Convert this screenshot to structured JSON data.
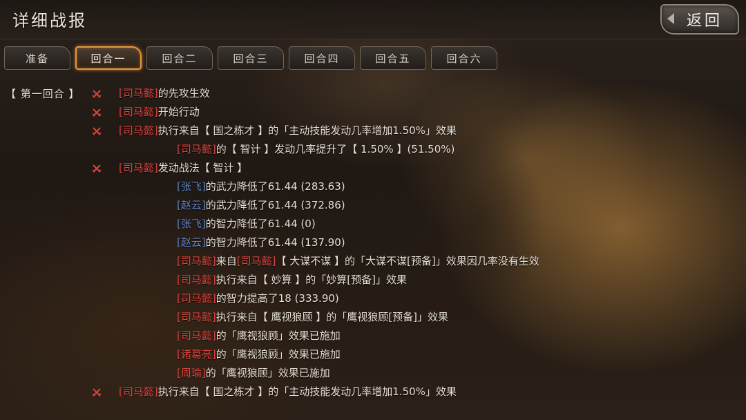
{
  "header": {
    "title": "详细战报",
    "back_label": "返回"
  },
  "tabs": [
    {
      "label": "准备",
      "active": false
    },
    {
      "label": "回合一",
      "active": true
    },
    {
      "label": "回合二",
      "active": false
    },
    {
      "label": "回合三",
      "active": false
    },
    {
      "label": "回合四",
      "active": false
    },
    {
      "label": "回合五",
      "active": false
    },
    {
      "label": "回合六",
      "active": false
    }
  ],
  "colors": {
    "accent_orange": "#e7973d",
    "hero_red": "#e0453f",
    "hero_blue": "#5f86c9",
    "text_main": "#e9e0d4"
  },
  "log": {
    "round_label": "【 第一回合 】",
    "lines": [
      {
        "icon": "crossed-swords-icon",
        "segs": [
          {
            "t": "[司马懿]",
            "c": "red"
          },
          {
            "t": "的先攻生效",
            "c": "w"
          }
        ]
      },
      {
        "icon": "crossed-swords-icon",
        "segs": [
          {
            "t": "[司马懿]",
            "c": "red"
          },
          {
            "t": "开始行动",
            "c": "w"
          }
        ]
      },
      {
        "icon": "crossed-swords-icon",
        "segs": [
          {
            "t": "[司马懿]",
            "c": "red"
          },
          {
            "t": "执行来自【 国之栋才 】的「主动技能发动几率增加1.50%」效果",
            "c": "w"
          }
        ]
      },
      {
        "icon": "",
        "segs": [
          {
            "t": "[司马懿]",
            "c": "red"
          },
          {
            "t": "的【 智计 】发动几率提升了【 1.50% 】(51.50%)",
            "c": "w"
          }
        ]
      },
      {
        "icon": "crossed-swords-icon",
        "segs": [
          {
            "t": "[司马懿]",
            "c": "red"
          },
          {
            "t": "发动战法【 智计 】",
            "c": "w"
          }
        ]
      },
      {
        "icon": "",
        "segs": [
          {
            "t": "[张飞]",
            "c": "blue"
          },
          {
            "t": "的武力降低了61.44 (283.63)",
            "c": "w"
          }
        ]
      },
      {
        "icon": "",
        "segs": [
          {
            "t": "[赵云]",
            "c": "blue"
          },
          {
            "t": "的武力降低了61.44 (372.86)",
            "c": "w"
          }
        ]
      },
      {
        "icon": "",
        "segs": [
          {
            "t": "[张飞]",
            "c": "blue"
          },
          {
            "t": "的智力降低了61.44 (0)",
            "c": "w"
          }
        ]
      },
      {
        "icon": "",
        "segs": [
          {
            "t": "[赵云]",
            "c": "blue"
          },
          {
            "t": "的智力降低了61.44 (137.90)",
            "c": "w"
          }
        ]
      },
      {
        "icon": "",
        "segs": [
          {
            "t": "[司马懿]",
            "c": "red"
          },
          {
            "t": "来自",
            "c": "w"
          },
          {
            "t": "[司马懿]",
            "c": "red"
          },
          {
            "t": "【 大谋不谋 】的「大谋不谋[预备]」效果因几率没有生效",
            "c": "w"
          }
        ]
      },
      {
        "icon": "",
        "segs": [
          {
            "t": "[司马懿]",
            "c": "red"
          },
          {
            "t": "执行来自【 妙算 】的「妙算[预备]」效果",
            "c": "w"
          }
        ]
      },
      {
        "icon": "",
        "segs": [
          {
            "t": "[司马懿]",
            "c": "red"
          },
          {
            "t": "的智力提高了18 (333.90)",
            "c": "w"
          }
        ]
      },
      {
        "icon": "",
        "segs": [
          {
            "t": "[司马懿]",
            "c": "red"
          },
          {
            "t": "执行来自【 鹰视狼顾 】的「鹰视狼顾[预备]」效果",
            "c": "w"
          }
        ]
      },
      {
        "icon": "",
        "segs": [
          {
            "t": "[司马懿]",
            "c": "red"
          },
          {
            "t": "的「鹰视狼顾」效果已施加",
            "c": "w"
          }
        ]
      },
      {
        "icon": "",
        "segs": [
          {
            "t": "[诸葛亮]",
            "c": "red"
          },
          {
            "t": "的「鹰视狼顾」效果已施加",
            "c": "w"
          }
        ]
      },
      {
        "icon": "",
        "segs": [
          {
            "t": "[周瑜]",
            "c": "red"
          },
          {
            "t": "的「鹰视狼顾」效果已施加",
            "c": "w"
          }
        ]
      },
      {
        "icon": "crossed-swords-icon",
        "segs": [
          {
            "t": "[司马懿]",
            "c": "red"
          },
          {
            "t": "执行来自【 国之栋才 】的「主动技能发动几率增加1.50%」效果",
            "c": "w"
          }
        ]
      }
    ]
  }
}
